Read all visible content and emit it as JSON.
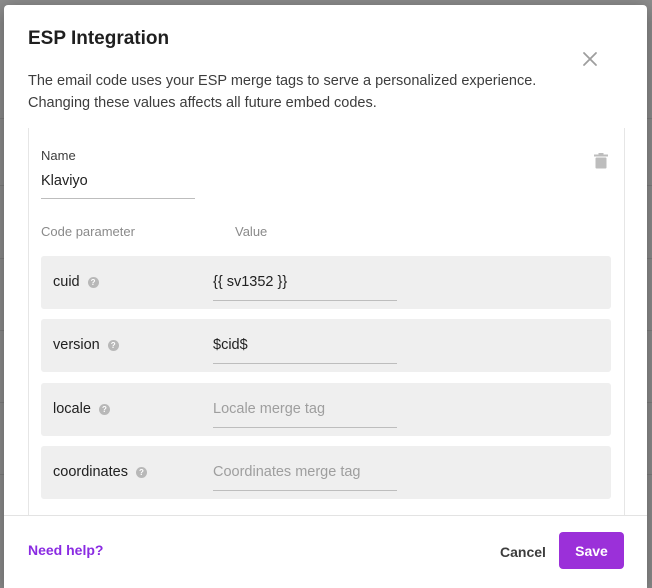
{
  "dialog": {
    "title": "ESP Integration",
    "description_line1": "The email code uses your ESP merge tags to serve a personalized experience.",
    "description_line2": "Changing these values affects all future embed codes."
  },
  "integration": {
    "name_label": "Name",
    "name_value": "Klaviyo",
    "col_param": "Code parameter",
    "col_value": "Value"
  },
  "params": [
    {
      "name": "cuid",
      "value": "{{ sv1352 }}",
      "placeholder": ""
    },
    {
      "name": "version",
      "value": "$cid$",
      "placeholder": ""
    },
    {
      "name": "locale",
      "value": "",
      "placeholder": "Locale merge tag"
    },
    {
      "name": "coordinates",
      "value": "",
      "placeholder": "Coordinates merge tag"
    }
  ],
  "footer": {
    "help": "Need help?",
    "cancel": "Cancel",
    "save": "Save"
  },
  "colors": {
    "accent": "#9b30d9",
    "link": "#8a2be2"
  },
  "icons": {
    "close": "close-icon",
    "delete": "trash-icon",
    "help": "help-icon"
  }
}
